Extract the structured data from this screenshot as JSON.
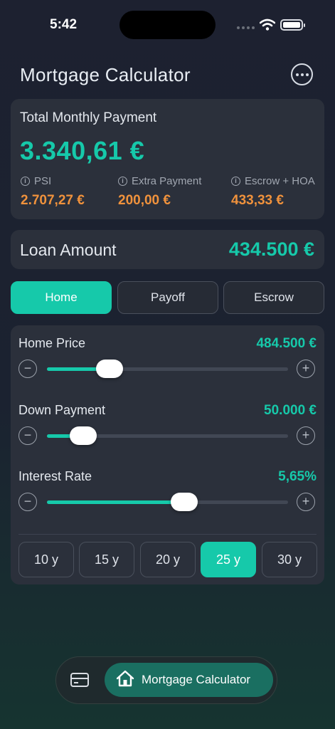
{
  "status_bar": {
    "time": "5:42"
  },
  "header": {
    "title": "Mortgage Calculator",
    "more_icon": "ellipsis-circle-icon"
  },
  "summary": {
    "label": "Total Monthly Payment",
    "total": "3.340,61 €",
    "items": [
      {
        "label": "PSI",
        "value": "2.707,27 €"
      },
      {
        "label": "Extra Payment",
        "value": "200,00 €"
      },
      {
        "label": "Escrow + HOA",
        "value": "433,33 €"
      }
    ]
  },
  "loan": {
    "label": "Loan Amount",
    "value": "434.500 €"
  },
  "tabs": [
    {
      "label": "Home",
      "active": true
    },
    {
      "label": "Payoff",
      "active": false
    },
    {
      "label": "Escrow",
      "active": false
    }
  ],
  "sliders": [
    {
      "label": "Home Price",
      "value": "484.500 €",
      "level": 0.26
    },
    {
      "label": "Down Payment",
      "value": "50.000 €",
      "level": 0.15
    },
    {
      "label": "Interest Rate",
      "value": "5,65%",
      "level": 0.57
    }
  ],
  "terms": [
    {
      "label": "10 y",
      "active": false
    },
    {
      "label": "15 y",
      "active": false
    },
    {
      "label": "20 y",
      "active": false
    },
    {
      "label": "25 y",
      "active": true
    },
    {
      "label": "30 y",
      "active": false
    }
  ],
  "bottom_nav": {
    "items": [
      {
        "icon": "credit-card-icon"
      },
      {
        "icon": "house-icon",
        "label": "Mortgage Calculator",
        "active": true
      }
    ]
  },
  "colors": {
    "accent": "#16c9aa",
    "warning": "#f0923c",
    "card": "#2b303b"
  }
}
